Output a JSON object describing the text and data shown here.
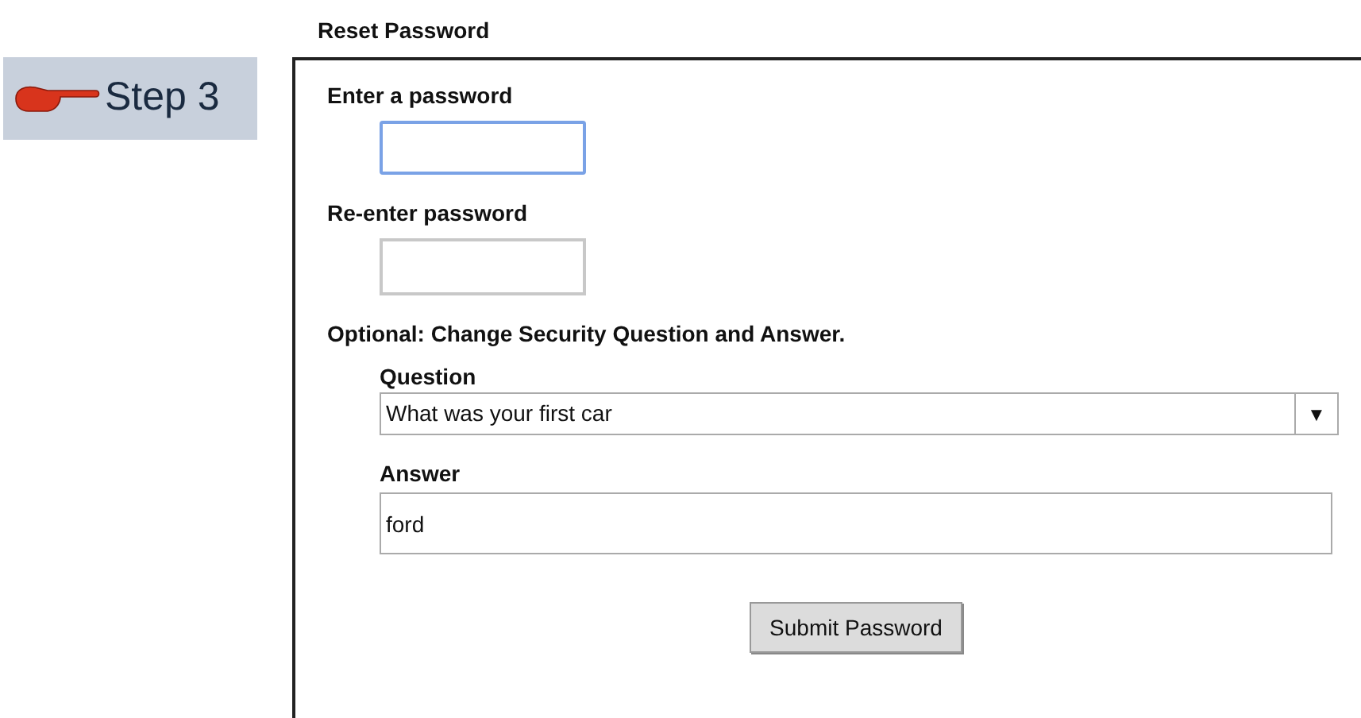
{
  "step": {
    "label": "Step 3"
  },
  "form": {
    "title": "Reset Password",
    "password_fields": [
      {
        "label": "Enter a password",
        "focused": true
      },
      {
        "label": "Re-enter password",
        "focused": false
      }
    ],
    "optional_heading": "Optional: Change Security Question and Answer.",
    "question": {
      "label": "Question",
      "value": "What was your first car",
      "arrow": "▼"
    },
    "answer": {
      "label": "Answer",
      "value": "ford"
    },
    "submit": "Submit Password"
  }
}
